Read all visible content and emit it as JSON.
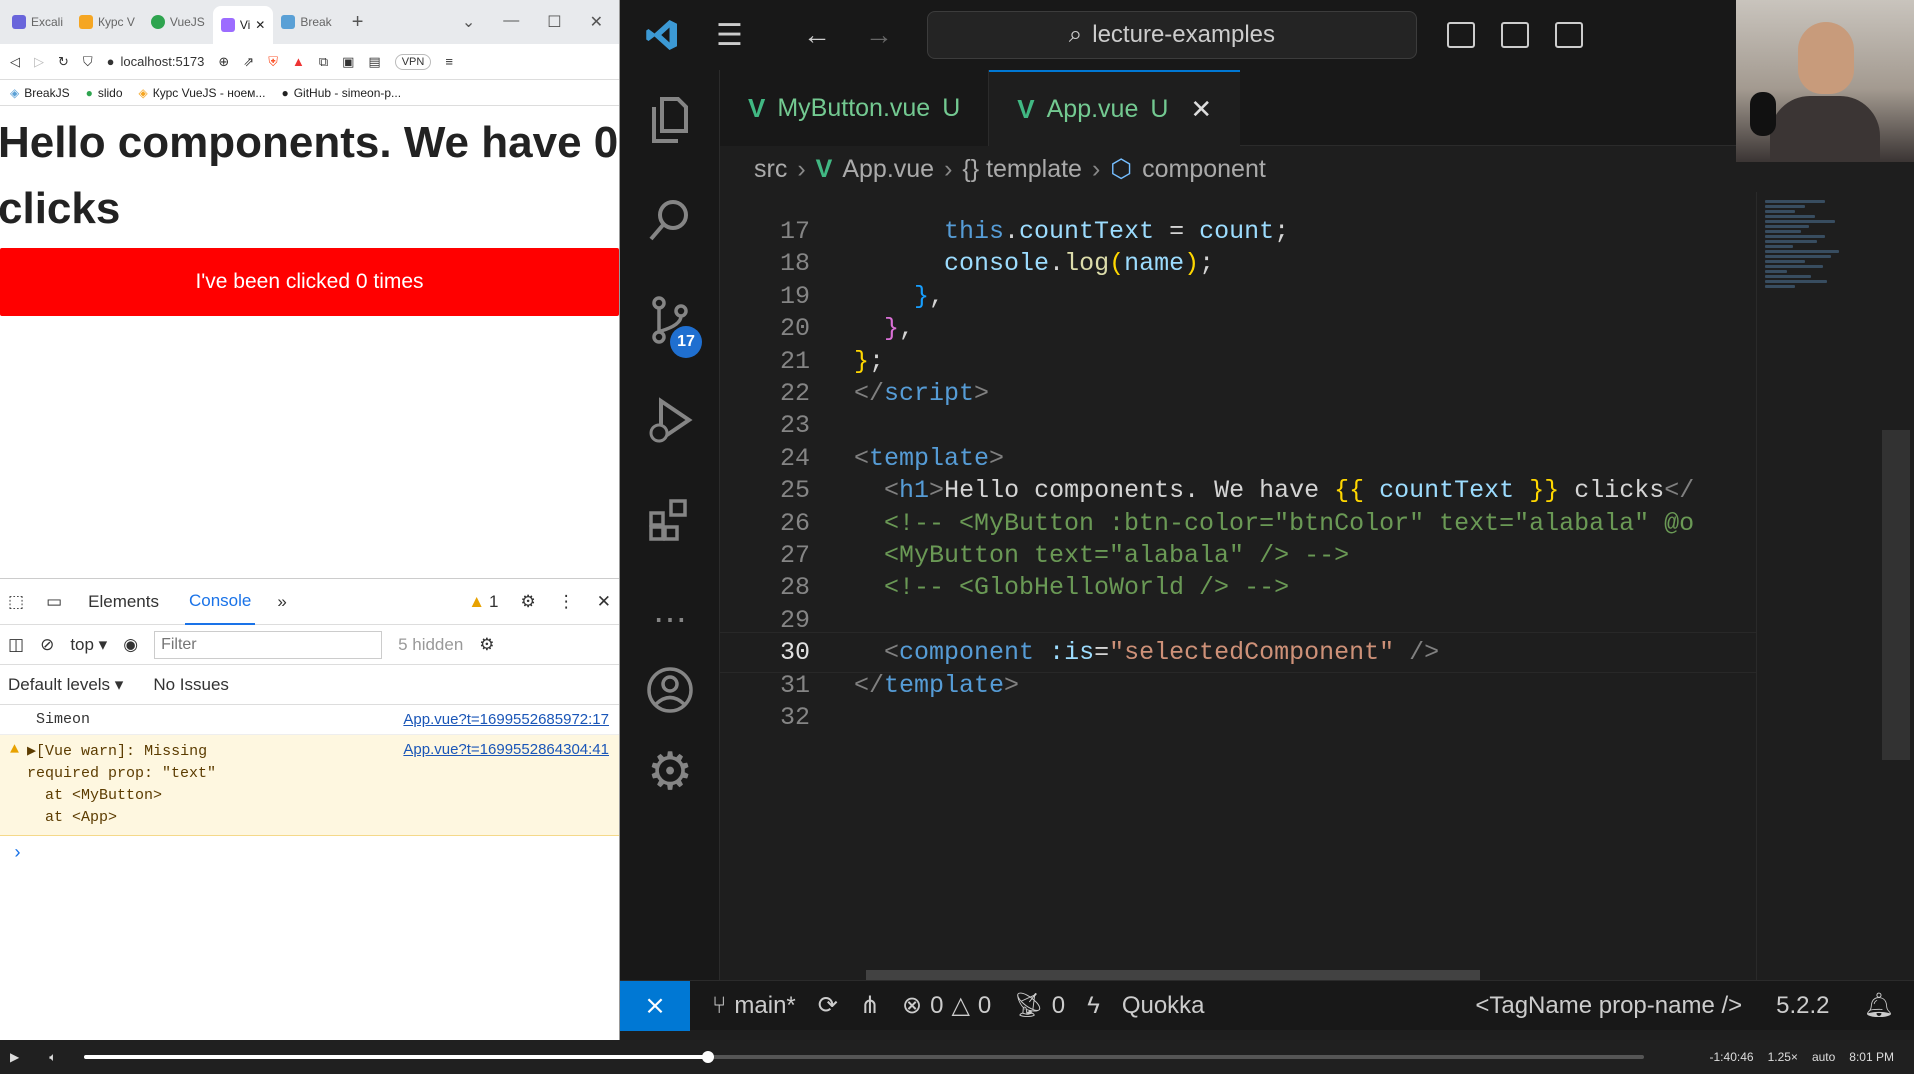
{
  "browser": {
    "tabs": [
      {
        "label": "Excali",
        "color": "#6965db"
      },
      {
        "label": "Курс V",
        "color": "#f5a623"
      },
      {
        "label": "VueJS",
        "color": "#2ea44f"
      },
      {
        "label": "Vi",
        "color": "#9c6cff",
        "active": true
      },
      {
        "label": "Break",
        "color": "#5aa0d6"
      }
    ],
    "new_tab": "+",
    "url": "localhost:5173",
    "vpn": "VPN",
    "bookmarks": [
      "BreakJS",
      "slido",
      "Курс VueJS - ноем...",
      "GitHub - simeon-p..."
    ],
    "page": {
      "heading": "Hello components. We have 0 clicks",
      "button_label": "I've been clicked 0 times"
    },
    "devtools": {
      "tabs": [
        "Elements",
        "Console"
      ],
      "more": "»",
      "warn_count": "1",
      "context": "top",
      "filter_placeholder": "Filter",
      "hidden": "5 hidden",
      "levels": "Default levels ▾",
      "issues": "No Issues",
      "logs": [
        {
          "text": "Simeon",
          "source": "App.vue?t=1699552685972:17"
        }
      ],
      "warning": {
        "text": "▶[Vue warn]: Missing\nrequired prop: \"text\"\n  at <MyButton>\n  at <App>",
        "source": "App.vue?t=1699552864304:41"
      },
      "prompt": "›"
    }
  },
  "vscode": {
    "search": "lecture-examples",
    "activity_badge": "17",
    "tabs": [
      {
        "name": "MyButton.vue",
        "status": "U",
        "active": false
      },
      {
        "name": "App.vue",
        "status": "U",
        "active": true,
        "close": "✕"
      }
    ],
    "breadcrumb": [
      "src",
      "App.vue",
      "{} template",
      "component"
    ],
    "current_line": "30",
    "status": {
      "branch": "main*",
      "errors": "0",
      "warnings": "0",
      "ports": "0",
      "quokka": "Quokka",
      "tagname": "<TagName prop-name />",
      "version": "5.2.2"
    }
  },
  "code_lines": [
    {
      "n": "17",
      "html": "<span class=\"tk-txt\">      </span><span class=\"tk-kw\">this</span><span class=\"tk-punc\">.</span><span class=\"tk-prop\">countText</span><span class=\"tk-punc\"> = </span><span class=\"tk-prop\">count</span><span class=\"tk-punc\">;</span>"
    },
    {
      "n": "18",
      "html": "<span class=\"tk-txt\">      </span><span class=\"tk-prop\">console</span><span class=\"tk-punc\">.</span><span class=\"tk-fn\">log</span><span class=\"tk-br1\">(</span><span class=\"tk-prop\">name</span><span class=\"tk-br1\">)</span><span class=\"tk-punc\">;</span>"
    },
    {
      "n": "19",
      "html": "<span class=\"tk-txt\">    </span><span class=\"tk-br3\">}</span><span class=\"tk-punc\">,</span>"
    },
    {
      "n": "20",
      "html": "<span class=\"tk-txt\">  </span><span class=\"tk-br2\">}</span><span class=\"tk-punc\">,</span>"
    },
    {
      "n": "21",
      "html": "<span class=\"tk-br1\">}</span><span class=\"tk-punc\">;</span>"
    },
    {
      "n": "22",
      "html": "<span class=\"tk-ang\">&lt;/</span><span class=\"tk-tag\">script</span><span class=\"tk-ang\">&gt;</span>"
    },
    {
      "n": "23",
      "html": ""
    },
    {
      "n": "24",
      "html": "<span class=\"tk-ang\">&lt;</span><span class=\"tk-tag\">template</span><span class=\"tk-ang\">&gt;</span>"
    },
    {
      "n": "25",
      "html": "<span class=\"tk-txt\">  </span><span class=\"tk-ang\">&lt;</span><span class=\"tk-tag\">h1</span><span class=\"tk-ang\">&gt;</span><span class=\"tk-txt\">Hello components. We have </span><span class=\"tk-br1\">{{</span><span class=\"tk-prop\"> countText </span><span class=\"tk-br1\">}}</span><span class=\"tk-txt\"> clicks</span><span class=\"tk-ang\">&lt;/</span>"
    },
    {
      "n": "26",
      "html": "<span class=\"tk-com\">  &lt;!-- &lt;MyButton :btn-color=\"btnColor\" text=\"alabala\" @o</span>"
    },
    {
      "n": "27",
      "html": "<span class=\"tk-com\">  &lt;MyButton text=\"alabala\" /&gt; --&gt;</span>"
    },
    {
      "n": "28",
      "html": "<span class=\"tk-com\">  &lt;!-- &lt;GlobHelloWorld /&gt; --&gt;</span>"
    },
    {
      "n": "29",
      "html": ""
    },
    {
      "n": "30",
      "html": "<span class=\"tk-txt\">  </span><span class=\"tk-ang\">&lt;</span><span class=\"tk-tag\">component</span><span class=\"tk-txt\"> </span><span class=\"tk-attr\">:is</span><span class=\"tk-punc\">=</span><span class=\"tk-str\">\"selectedComponent\"</span><span class=\"tk-txt\"> </span><span class=\"tk-ang\">/&gt;</span>"
    },
    {
      "n": "31",
      "html": "<span class=\"tk-ang\">&lt;/</span><span class=\"tk-tag\">template</span><span class=\"tk-ang\">&gt;</span>"
    },
    {
      "n": "32",
      "html": ""
    }
  ],
  "player": {
    "time": "-1:40:46",
    "speed": "1.25×",
    "quality": "auto",
    "clock": "8:01 PM",
    "progress": 0.4
  }
}
